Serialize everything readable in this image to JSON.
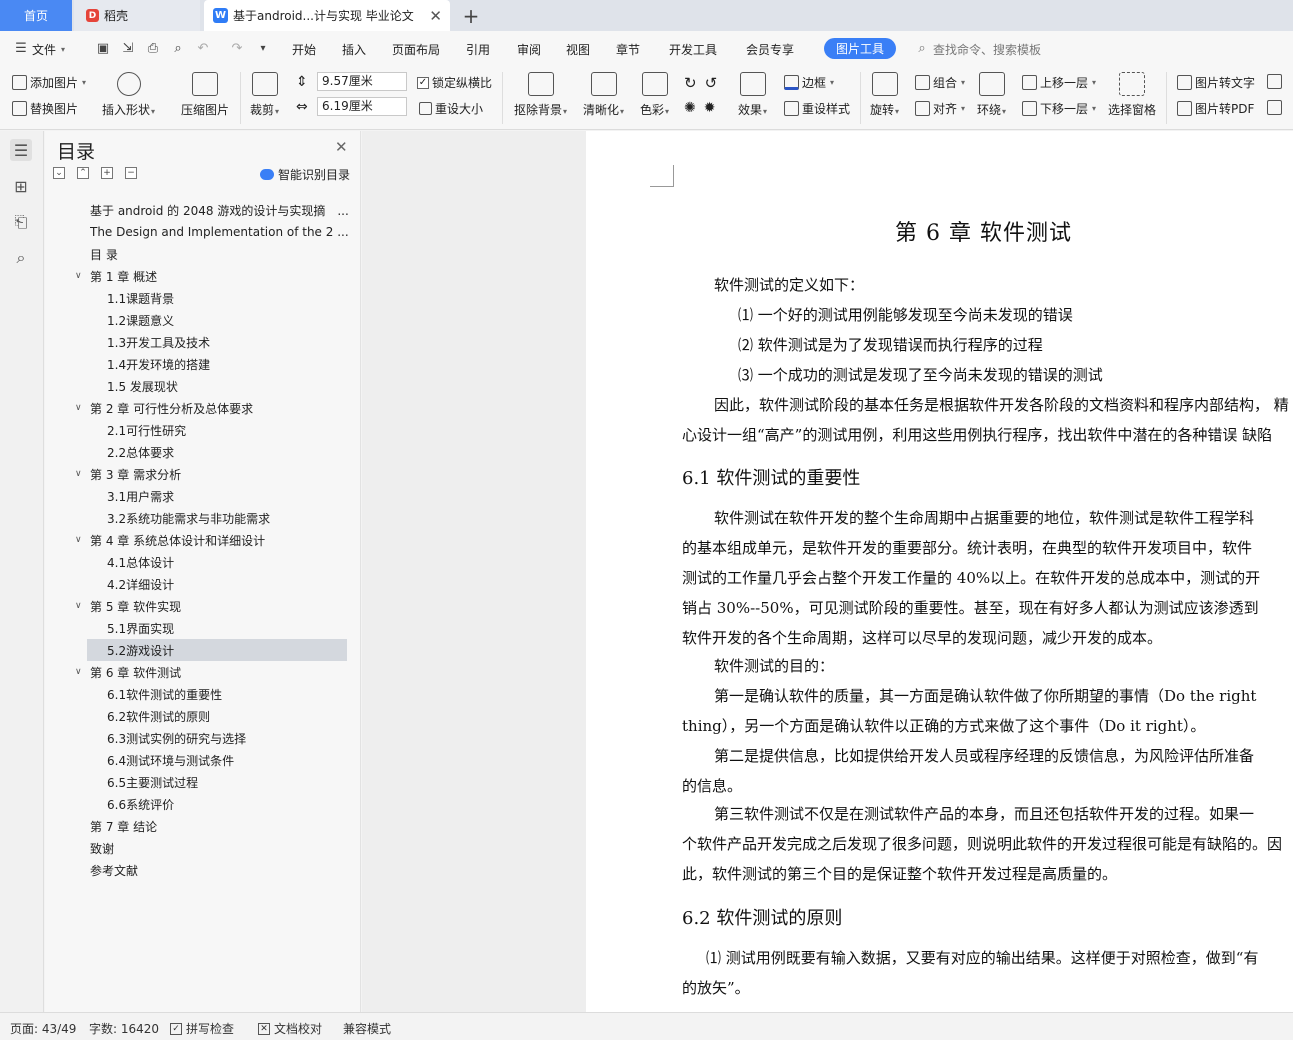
{
  "tabs": {
    "home": "首页",
    "daoke": "稻壳",
    "doc": "基于android...计与实现 毕业论文"
  },
  "menu": {
    "file": "文件",
    "items": [
      "开始",
      "插入",
      "页面布局",
      "引用",
      "审阅",
      "视图",
      "章节",
      "开发工具",
      "会员专享"
    ],
    "active": "图片工具",
    "search": "查找命令、搜索模板"
  },
  "ribbon": {
    "add_image": "添加图片",
    "replace_image": "替换图片",
    "insert_shape": "插入形状",
    "compress": "压缩图片",
    "crop": "裁剪",
    "width": "9.57厘米",
    "height": "6.19厘米",
    "lock_ratio": "锁定纵横比",
    "reset_size": "重设大小",
    "remove_bg": "抠除背景",
    "sharpen": "清晰化",
    "color": "色彩",
    "effect": "效果",
    "border": "边框",
    "reset_style": "重设样式",
    "rotate": "旋转",
    "group": "组合",
    "align": "对齐",
    "wrap": "环绕",
    "bring_forward": "上移一层",
    "send_backward": "下移一层",
    "select_pane": "选择窗格",
    "img_to_text": "图片转文字",
    "img_to_pdf": "图片转PDF"
  },
  "toc": {
    "title": "目录",
    "smart": "智能识别目录",
    "items": [
      {
        "level": 0,
        "text": "基于 android 的 2048 游戏的设计与实现摘　..."
      },
      {
        "level": 0,
        "text": "The Design and Implementation of the 2 ..."
      },
      {
        "level": 0,
        "text": "目 录"
      },
      {
        "level": 1,
        "text": "第 1 章 概述"
      },
      {
        "level": 2,
        "text": "1.1课题背景"
      },
      {
        "level": 2,
        "text": "1.2课题意义"
      },
      {
        "level": 2,
        "text": "1.3开发工具及技术"
      },
      {
        "level": 2,
        "text": "1.4开发环境的搭建"
      },
      {
        "level": 2,
        "text": "1.5 发展现状"
      },
      {
        "level": 1,
        "text": "第 2 章 可行性分析及总体要求"
      },
      {
        "level": 2,
        "text": "2.1可行性研究"
      },
      {
        "level": 2,
        "text": "2.2总体要求"
      },
      {
        "level": 1,
        "text": "第 3 章 需求分析"
      },
      {
        "level": 2,
        "text": "3.1用户需求"
      },
      {
        "level": 2,
        "text": "3.2系统功能需求与非功能需求"
      },
      {
        "level": 1,
        "text": "第 4 章 系统总体设计和详细设计"
      },
      {
        "level": 2,
        "text": "4.1总体设计"
      },
      {
        "level": 2,
        "text": "4.2详细设计"
      },
      {
        "level": 1,
        "text": "第 5 章 软件实现"
      },
      {
        "level": 2,
        "text": "5.1界面实现"
      },
      {
        "level": 2,
        "text": "5.2游戏设计",
        "selected": true
      },
      {
        "level": 1,
        "text": "第 6 章 软件测试"
      },
      {
        "level": 2,
        "text": "6.1软件测试的重要性"
      },
      {
        "level": 2,
        "text": "6.2软件测试的原则"
      },
      {
        "level": 2,
        "text": "6.3测试实例的研究与选择"
      },
      {
        "level": 2,
        "text": "6.4测试环境与测试条件"
      },
      {
        "level": 2,
        "text": "6.5主要测试过程"
      },
      {
        "level": 2,
        "text": "6.6系统评价"
      },
      {
        "level": 0,
        "text": "第 7 章 结论"
      },
      {
        "level": 0,
        "text": "致谢"
      },
      {
        "level": 0,
        "text": "参考文献"
      }
    ]
  },
  "doc": {
    "chapter": "第  6 章  软件测试",
    "lines": [
      {
        "t": "软件测试的定义如下："
      },
      {
        "t": "⑴   一个好的测试用例能够发现至今尚未发现的错误"
      },
      {
        "t": "⑵   软件测试是为了发现错误而执行程序的过程"
      },
      {
        "t": "⑶ 一个成功的测试是发现了至今尚未发现的错误的测试"
      },
      {
        "t": "因此，软件测试阶段的基本任务是根据软件开发各阶段的文档资料和程序内部结构，  精"
      },
      {
        "t": "心设计一组“高产”的测试用例，利用这些用例执行程序，找出软件中潜在的各种错误  缺陷"
      },
      {
        "t": "6.1 软件测试的重要性"
      },
      {
        "t": "软件测试在软件开发的整个生命周期中占据重要的地位，软件测试是软件工程学科"
      },
      {
        "t": "的基本组成单元，是软件开发的重要部分。统计表明，在典型的软件开发项目中，软件"
      },
      {
        "t": "测试的工作量几乎会占整个开发工作量的  40%以上。在软件开发的总成本中，测试的开"
      },
      {
        "t": "销占 30%--50%，可见测试阶段的重要性。甚至，现在有好多人都认为测试应该渗透到"
      },
      {
        "t": "软件开发的各个生命周期，这样可以尽早的发现问题，减少开发的成本。"
      },
      {
        "t": "软件测试的目的："
      },
      {
        "t": "第一是确认软件的质量，其一方面是确认软件做了你所期望的事情（Do the right"
      },
      {
        "t": "thing），另一个方面是确认软件以正确的方式来做了这个事件（Do it right）。"
      },
      {
        "t": "第二是提供信息，比如提供给开发人员或程序经理的反馈信息，为风险评估所准备"
      },
      {
        "t": "的信息。"
      },
      {
        "t": "第三软件测试不仅是在测试软件产品的本身，而且还包括软件开发的过程。如果一"
      },
      {
        "t": "个软件产品开发完成之后发现了很多问题，则说明此软件的开发过程很可能是有缺陷的。因"
      },
      {
        "t": "此，软件测试的第三个目的是保证整个软件开发过程是高质量的。"
      },
      {
        "t": "6.2 软件测试的原则"
      },
      {
        "t": "⑴ 测试用例既要有输入数据，又要有对应的输出结果。这样便于对照检查，做到“有"
      },
      {
        "t": "的放矢”。"
      }
    ]
  },
  "status": {
    "page": "页面: 43/49",
    "words": "字数: 16420",
    "spell": "拼写检查",
    "proof": "文档校对",
    "compat": "兼容模式"
  }
}
